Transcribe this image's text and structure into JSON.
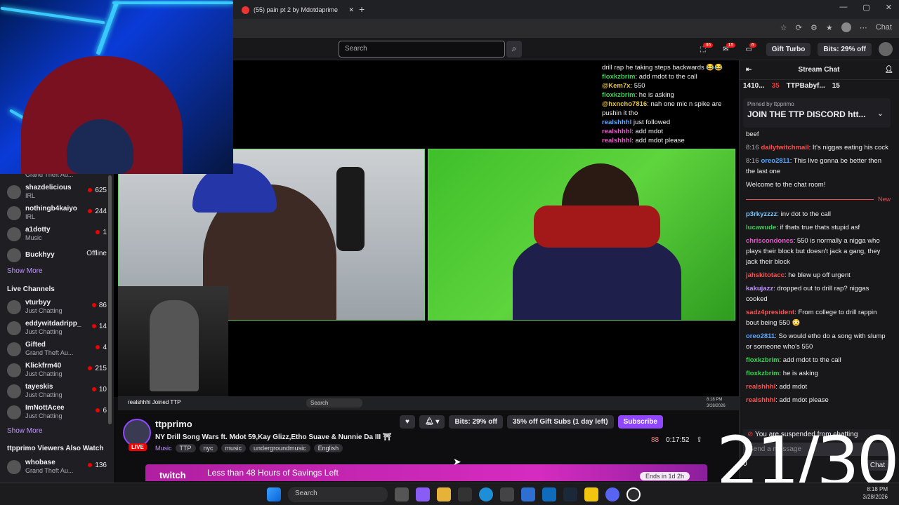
{
  "browser": {
    "tab_title": "(55) pain pt 2 by Mdotdaprime",
    "new_tab": "+",
    "window_controls": [
      "—",
      "▢",
      "✕"
    ],
    "chat_label": "Chat"
  },
  "twitch_header": {
    "search_placeholder": "Search",
    "notif_counts": [
      "36",
      "15",
      "6"
    ],
    "gift_turbo": "Gift Turbo",
    "bits_offer": "Bits: 29% off"
  },
  "sidebar": {
    "truncated_top": "Grand Theft Au...",
    "followed": [
      {
        "name": "shazdelicious",
        "game": "IRL",
        "viewers": "625"
      },
      {
        "name": "nothingb4kaiyo",
        "game": "IRL",
        "viewers": "244"
      },
      {
        "name": "a1dotty",
        "game": "Music",
        "viewers": "1"
      },
      {
        "name": "Buckhyy",
        "game": "",
        "viewers": "Offline"
      }
    ],
    "show_more": "Show More",
    "live_channels_title": "Live Channels",
    "live": [
      {
        "name": "vturbyy",
        "game": "Just Chatting",
        "viewers": "86"
      },
      {
        "name": "eddywitdadripp_",
        "game": "Just Chatting",
        "viewers": "14"
      },
      {
        "name": "Gifted",
        "game": "Grand Theft Au...",
        "viewers": "4"
      },
      {
        "name": "Klickfrm40",
        "game": "Just Chatting",
        "viewers": "215"
      },
      {
        "name": "tayeskis",
        "game": "Just Chatting",
        "viewers": "10"
      },
      {
        "name": "ImNottAcee",
        "game": "Just Chatting",
        "viewers": "6"
      }
    ],
    "show_more_2": "Show More",
    "also_watch_title": "ttpprimo Viewers Also Watch",
    "also": [
      {
        "name": "whobase",
        "game": "Grand Theft Au...",
        "viewers": "136"
      }
    ]
  },
  "overlay_chat": [
    {
      "user": "",
      "text": "drill rap he taking steps backwards 😂😂",
      "color": "#efeff1"
    },
    {
      "user": "floxkzbrim",
      "text": ": add mdot to the call",
      "color": "#39d353"
    },
    {
      "user": "@Kem7x",
      "text": ": 550",
      "color": "#e8c33c"
    },
    {
      "user": "floxkzbrim",
      "text": ": he is asking",
      "color": "#39d353"
    },
    {
      "user": "@hxncho7816",
      "text": ": nah one mic n spike are pushin it tho",
      "color": "#e8c33c"
    },
    {
      "user": "realshhhl",
      "text": " just followed",
      "color": "#5aa7ff"
    },
    {
      "user": "realshhhl",
      "text": ": add mdot",
      "color": "#e05cc8"
    },
    {
      "user": "realshhhl",
      "text": ": add mdot please",
      "color": "#e05cc8"
    }
  ],
  "nested_taskbar": {
    "search": "Search",
    "ticker": "realshhhl Joined TTP",
    "time": "8:18 PM",
    "date": "3/28/2026"
  },
  "stream_info": {
    "channel": "ttpprimo",
    "live": "LIVE",
    "title": "NY Drill Song Wars ft. Mdot 59,Kay Glizz,Etho Suave & Nunnie Da III ⛩",
    "category": "Music",
    "tags": [
      "TTP",
      "nyc",
      "music",
      "undergroundmusic",
      "English"
    ],
    "bits_btn": "Bits: 29% off",
    "gift_subs_btn": "35% off Gift Subs (1 day left)",
    "subscribe_btn": "Subscribe",
    "viewers": "88",
    "uptime": "0:17:52"
  },
  "banner": {
    "logo": "twitch",
    "text": "Less than 48 Hours of Savings Left",
    "ends": "Ends in 1d 2h"
  },
  "chat": {
    "title": "Stream Chat",
    "gift_row": [
      "1410...",
      "35",
      "TTPBabyf...",
      "15"
    ],
    "pinned_label": "Pinned by ttpprimo",
    "pinned_text": "JOIN THE TTP DISCORD htt...",
    "messages": [
      {
        "time": "",
        "user": "",
        "text": "beef",
        "color": "#efeff1"
      },
      {
        "time": "8:16",
        "user": "dailytwitchmail",
        "text": ": It's niggas eating his cock",
        "color": "#ff4f4f"
      },
      {
        "time": "8:16",
        "user": "oreo2811",
        "text": ": This live gonna be better then the last one",
        "color": "#5aa7ff"
      },
      {
        "time": "",
        "user": "",
        "text": "Welcome to the chat room!",
        "color": "#efeff1"
      }
    ],
    "new_label": "New",
    "messages_after": [
      {
        "user": "p3rkyzzzz",
        "text": ": inv dot to the call",
        "color": "#7ac8ff"
      },
      {
        "user": "lucawude",
        "text": ": if thats true thats stupid asf",
        "color": "#39d353"
      },
      {
        "user": "chriscondones",
        "text": ": 550 is normally a nigga who plays their block but doesn't jack a gang, they jack their block",
        "color": "#e05cc8"
      },
      {
        "user": "jahskitotacc",
        "text": ": he blew up off urgent",
        "color": "#ff4f4f"
      },
      {
        "user": "kakujazz",
        "text": ": dropped out to drill rap? niggas cooked",
        "color": "#bf94ff"
      },
      {
        "user": "sadz4president",
        "text": ": From college to drill rappin bout being 550 😳",
        "color": "#ff4f4f"
      },
      {
        "user": "oreo2811",
        "text": ": So would etho do a song with slump or someone who's 550",
        "color": "#5aa7ff"
      },
      {
        "user": "floxkzbrim",
        "text": ": add mdot to the call",
        "color": "#39d353"
      },
      {
        "user": "floxkzbrim",
        "text": ": he is asking",
        "color": "#39d353"
      },
      {
        "user": "realshhhl",
        "text": ": add mdot",
        "color": "#ff4f4f"
      },
      {
        "user": "realshhhl",
        "text": ": add mdot please",
        "color": "#ff4f4f"
      }
    ],
    "suspended": "You are suspended from chatting",
    "send_placeholder": "Send a message",
    "points": "0",
    "chat_btn": "Chat"
  },
  "overlay_counter": "21/30",
  "taskbar": {
    "search": "Search",
    "time": "8:18 PM",
    "date": "3/28/2026"
  }
}
